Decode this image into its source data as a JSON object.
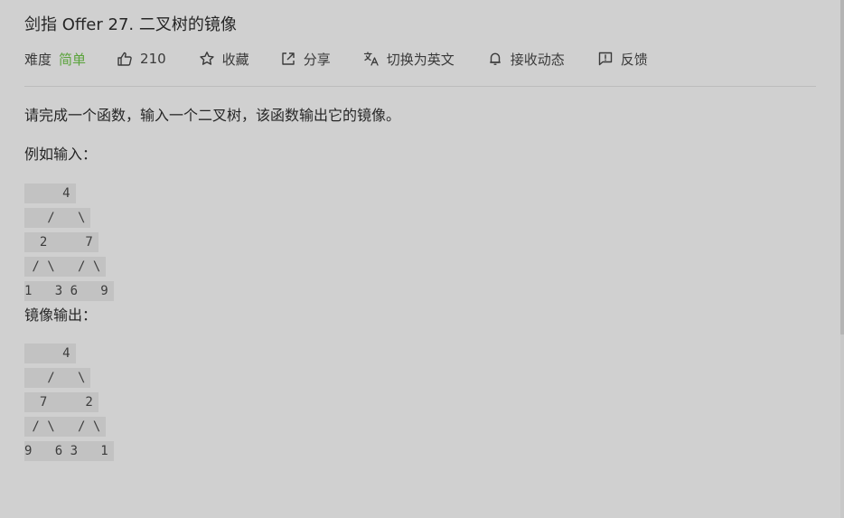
{
  "problem": {
    "title": "剑指 Offer 27. 二叉树的镜像",
    "difficulty_label": "难度",
    "difficulty_value": "简单",
    "likes": "210",
    "favorite_label": "收藏",
    "share_label": "分享",
    "switch_lang_label": "切换为英文",
    "subscribe_label": "接收动态",
    "feedback_label": "反馈"
  },
  "content": {
    "description": "请完成一个函数，输入一个二叉树，该函数输出它的镜像。",
    "input_label": "例如输入：",
    "input_lines": [
      "     4",
      "   /   \\",
      "  2     7",
      " / \\   / \\",
      "1   3 6   9"
    ],
    "output_label": "镜像输出：",
    "output_lines": [
      "     4",
      "   /   \\",
      "  7     2",
      " / \\   / \\",
      "9   6 3   1"
    ]
  },
  "colors": {
    "difficulty_easy": "#5aa33b",
    "background": "#d0d0d0",
    "code_bg": "#c2c2c2"
  }
}
